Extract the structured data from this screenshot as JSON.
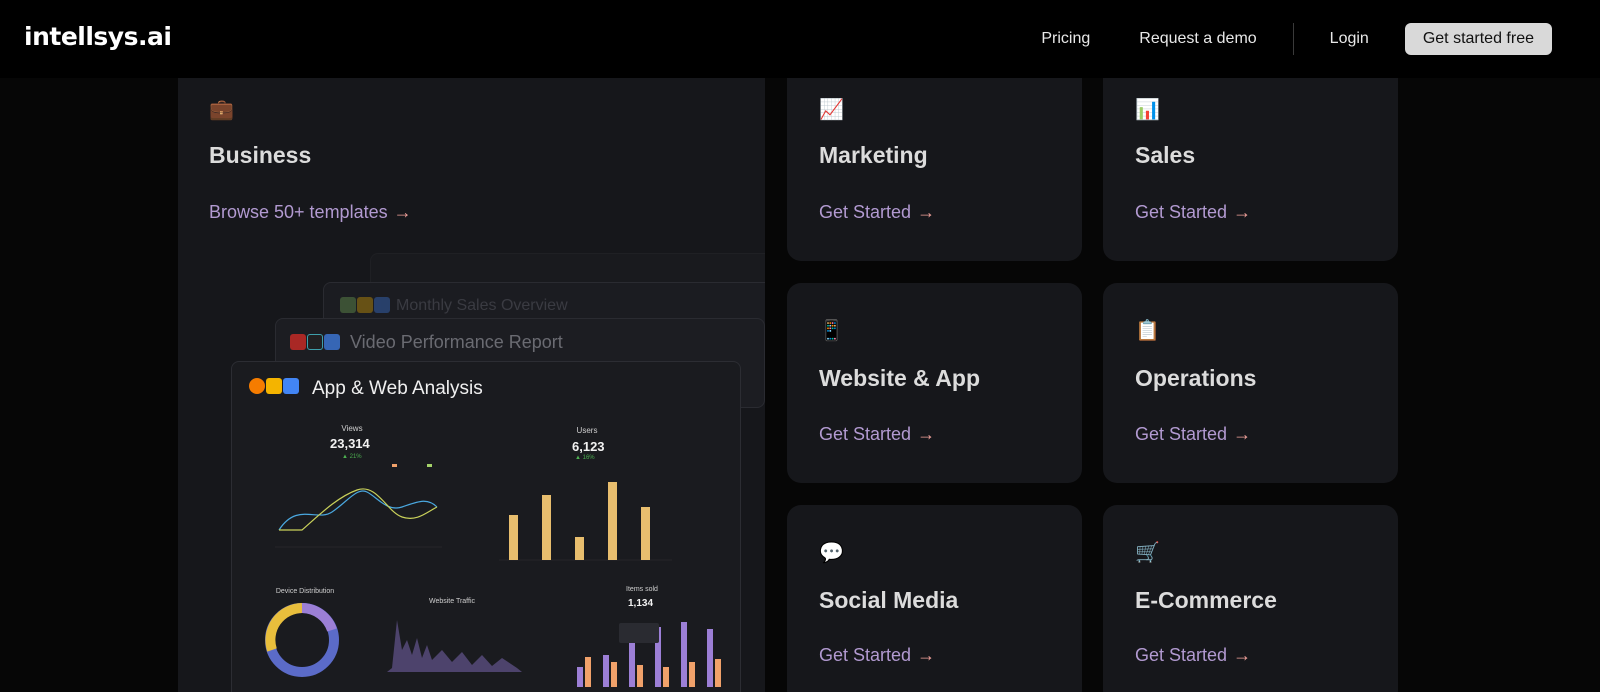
{
  "header": {
    "logo": "intellsys.ai",
    "nav": {
      "pricing": "Pricing",
      "request_demo": "Request a demo",
      "login": "Login",
      "get_started": "Get started free"
    }
  },
  "business": {
    "emoji": "💼",
    "title": "Business",
    "link": "Browse 50+ templates",
    "arrow": "→",
    "preview": {
      "panel1_title": "Monthly Sales Overview",
      "panel2_title": "Video Performance Report",
      "panel3_title": "App & Web Analysis",
      "views_label": "Views",
      "views_value": "23,314",
      "views_delta": "▲ 21%",
      "users_label": "Users",
      "users_value": "6,123",
      "users_delta": "▲ 16%",
      "device_label": "Device Distribution",
      "traffic_label": "Website Traffic",
      "items_label": "Items sold",
      "items_value": "1,134"
    }
  },
  "cards": [
    {
      "emoji": "📈",
      "title": "Marketing",
      "link": "Get Started"
    },
    {
      "emoji": "📊",
      "title": "Sales",
      "link": "Get Started"
    },
    {
      "emoji": "📱",
      "title": "Website & App",
      "link": "Get Started"
    },
    {
      "emoji": "📋",
      "title": "Operations",
      "link": "Get Started"
    },
    {
      "emoji": "💬",
      "title": "Social Media",
      "link": "Get Started"
    },
    {
      "emoji": "🛒",
      "title": "E-Commerce",
      "link": "Get Started"
    }
  ],
  "colors": {
    "link": "#b29ad1",
    "arrow": "#f0a09a",
    "card_bg": "#16171b",
    "bar_gold": "#e8be6e",
    "bar_purple": "#9c7fd6",
    "bar_orange": "#f0a16a"
  }
}
